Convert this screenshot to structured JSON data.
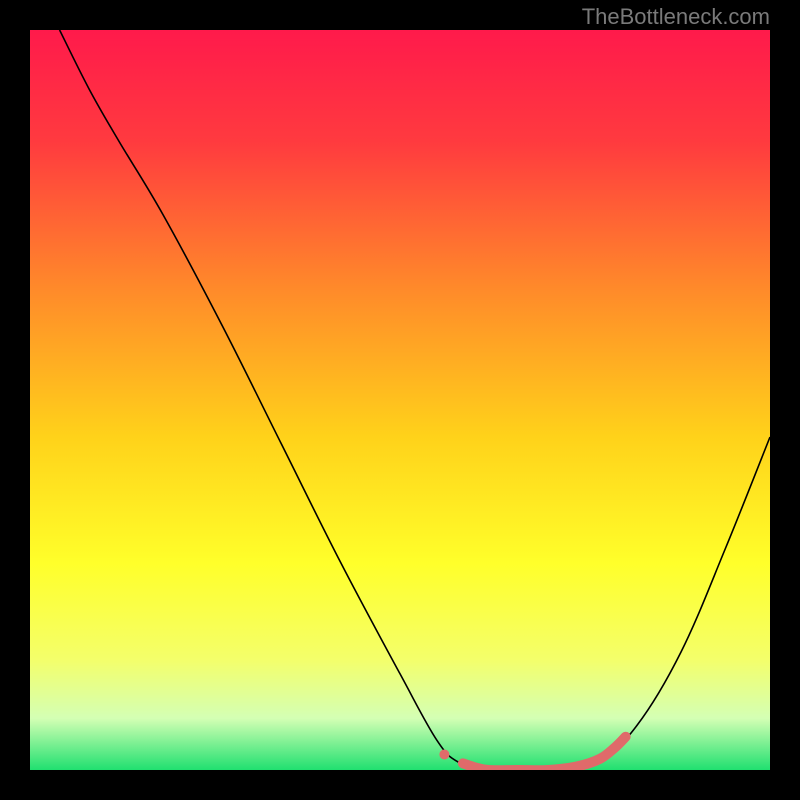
{
  "attribution": "TheBottleneck.com",
  "chart_data": {
    "type": "line",
    "title": "",
    "xlabel": "",
    "ylabel": "",
    "xlim": [
      0,
      100
    ],
    "ylim": [
      0,
      100
    ],
    "gradient_stops": [
      {
        "offset": 0.0,
        "color": "#ff1a4b"
      },
      {
        "offset": 0.15,
        "color": "#ff3a3f"
      },
      {
        "offset": 0.35,
        "color": "#ff8a2a"
      },
      {
        "offset": 0.55,
        "color": "#ffd21a"
      },
      {
        "offset": 0.72,
        "color": "#ffff2a"
      },
      {
        "offset": 0.85,
        "color": "#f4ff6a"
      },
      {
        "offset": 0.93,
        "color": "#d4ffb4"
      },
      {
        "offset": 1.0,
        "color": "#20e070"
      }
    ],
    "series": [
      {
        "name": "bottleneck-curve",
        "color": "#000000",
        "width": 1.6,
        "points": [
          {
            "x": 4.0,
            "y": 100.0
          },
          {
            "x": 8.0,
            "y": 92.0
          },
          {
            "x": 12.0,
            "y": 85.0
          },
          {
            "x": 18.0,
            "y": 75.0
          },
          {
            "x": 26.0,
            "y": 60.0
          },
          {
            "x": 34.0,
            "y": 44.0
          },
          {
            "x": 42.0,
            "y": 28.0
          },
          {
            "x": 50.0,
            "y": 13.0
          },
          {
            "x": 55.0,
            "y": 4.0
          },
          {
            "x": 58.0,
            "y": 1.0
          },
          {
            "x": 62.0,
            "y": 0.0
          },
          {
            "x": 70.0,
            "y": 0.0
          },
          {
            "x": 77.0,
            "y": 1.5
          },
          {
            "x": 82.0,
            "y": 6.0
          },
          {
            "x": 88.0,
            "y": 16.0
          },
          {
            "x": 94.0,
            "y": 30.0
          },
          {
            "x": 100.0,
            "y": 45.0
          }
        ]
      },
      {
        "name": "highlight-band",
        "color": "#e06a6a",
        "width": 10,
        "points": [
          {
            "x": 56.0,
            "y": 2.1
          },
          {
            "x": 57.0,
            "y": 1.5
          },
          {
            "x": 58.5,
            "y": 0.9
          },
          {
            "x": 60.0,
            "y": 0.4
          },
          {
            "x": 62.0,
            "y": 0.0
          },
          {
            "x": 66.0,
            "y": 0.0
          },
          {
            "x": 70.0,
            "y": 0.0
          },
          {
            "x": 74.0,
            "y": 0.5
          },
          {
            "x": 77.0,
            "y": 1.5
          },
          {
            "x": 79.0,
            "y": 3.0
          },
          {
            "x": 80.5,
            "y": 4.5
          }
        ]
      }
    ]
  }
}
